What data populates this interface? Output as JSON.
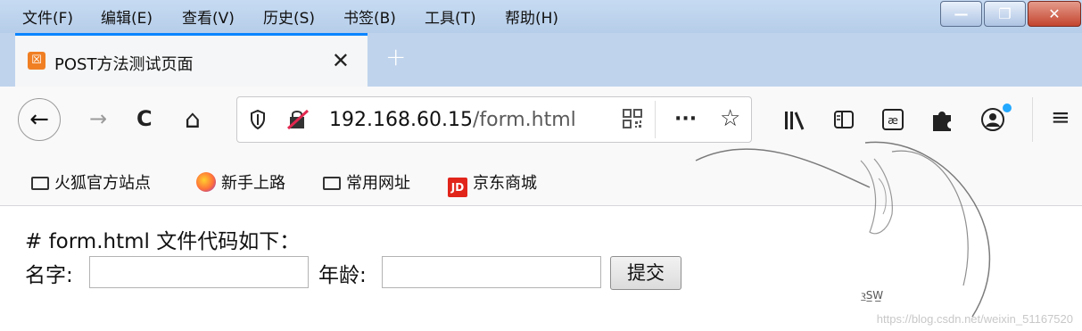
{
  "menubar": {
    "items": [
      "文件(F)",
      "编辑(E)",
      "查看(V)",
      "历史(S)",
      "书签(B)",
      "工具(T)",
      "帮助(H)"
    ]
  },
  "window_controls": {
    "minimize": "—",
    "restore": "❐",
    "close": "✕"
  },
  "tab": {
    "title": "POST方法测试页面",
    "icon_text": "☒",
    "close": "✕"
  },
  "new_tab": "+",
  "nav": {
    "back": "←",
    "forward": "→",
    "reload": "C",
    "home": "⌂",
    "url_host": "192.168.60.15",
    "url_path": "/form.html"
  },
  "bookmarks": [
    {
      "label": "火狐官方站点",
      "icon": "folder-icon"
    },
    {
      "label": "新手上路",
      "icon": "firefox-icon"
    },
    {
      "label": "常用网址",
      "icon": "folder-icon"
    },
    {
      "label": "京东商城",
      "icon": "jd-icon",
      "badge": "JD"
    }
  ],
  "page": {
    "heading": "# form.html 文件代码如下：",
    "name_label": "名字:",
    "age_label": "年龄:",
    "name_value": "",
    "age_value": "",
    "submit": "提交"
  },
  "watermark": {
    "url": "https://blog.csdn.net/weixin_51167520",
    "mark": "ꝛ̲S̲W̲"
  },
  "colors": {
    "accent": "#0a84ff",
    "tab_icon": "#f07f24",
    "jd": "#e1251b",
    "menubar": "#c6dbf2"
  }
}
